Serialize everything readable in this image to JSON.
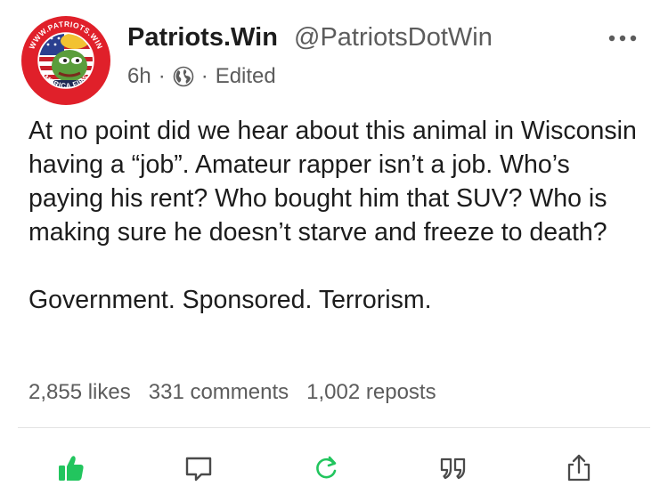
{
  "post": {
    "author_name": "Patriots.Win",
    "author_handle": "@PatriotsDotWin",
    "time": "6h",
    "dot": "·",
    "edited": "Edited",
    "paragraphs": [
      "At no point did we hear about this animal in Wisconsin having a “job”. Amateur rapper isn’t a job. Who’s paying his rent? Who bought him that SUV? Who is making sure he doesn’t starve and freeze to death?",
      "Government. Sponsored. Terrorism."
    ]
  },
  "avatar": {
    "top_text": "WWW.PATRIOTS.WIN",
    "bottom_text": "AMERICA FIRST",
    "ring_color": "#e0202a"
  },
  "stats": {
    "likes": "2,855 likes",
    "comments": "331 comments",
    "reposts": "1,002 reposts"
  },
  "actions": [
    {
      "name": "like",
      "icon": "thumbs-up-icon",
      "color": "#22c55e"
    },
    {
      "name": "comment",
      "icon": "comment-icon",
      "color": "#4a4a4a"
    },
    {
      "name": "repost",
      "icon": "repost-icon",
      "color": "#22c55e"
    },
    {
      "name": "quote",
      "icon": "quote-icon",
      "color": "#4a4a4a"
    },
    {
      "name": "share",
      "icon": "share-icon",
      "color": "#4a4a4a"
    }
  ]
}
